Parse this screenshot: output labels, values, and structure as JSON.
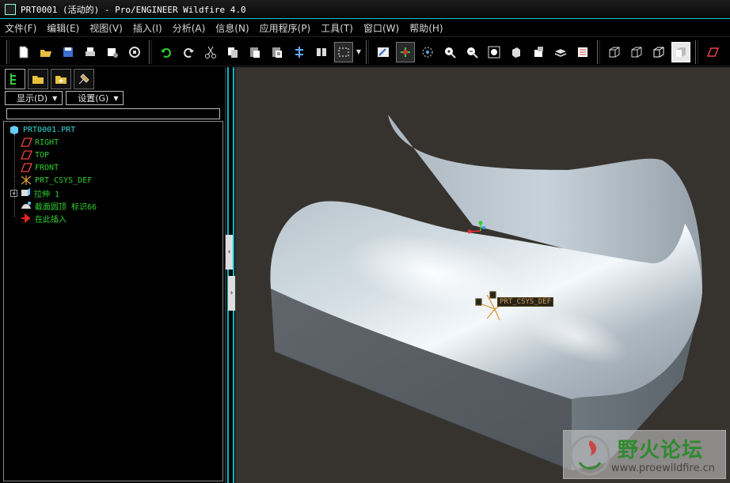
{
  "window": {
    "title": "PRT0001 (活动的) - Pro/ENGINEER Wildfire 4.0"
  },
  "menubar": {
    "items": [
      "文件(F)",
      "编辑(E)",
      "视图(V)",
      "插入(I)",
      "分析(A)",
      "信息(N)",
      "应用程序(P)",
      "工具(T)",
      "窗口(W)",
      "帮助(H)"
    ]
  },
  "toolbar": {
    "icons": [
      "new-file-icon",
      "open-file-icon",
      "save-icon",
      "print-icon",
      "send-email-icon",
      "regen-icon",
      "undo-icon",
      "redo-icon",
      "cut-icon",
      "copy-icon",
      "paste-icon",
      "paste-special-icon",
      "regenerate-icon",
      "find-icon",
      "select-box-icon",
      "repaint-icon",
      "spin-center-icon",
      "orient-icon",
      "zoom-in-icon",
      "zoom-out-icon",
      "refit-icon",
      "reorient-icon",
      "saved-views-icon",
      "layers-icon",
      "view-manager-icon",
      "wireframe-icon",
      "hidden-line-icon",
      "no-hidden-icon",
      "shading-icon",
      "datum-plane-icon"
    ]
  },
  "navigator": {
    "tabs": [
      "model-tree-tab",
      "folder-browser-tab",
      "favorites-tab",
      "connections-tab"
    ],
    "show_label": "显示(D)",
    "settings_label": "设置(G)",
    "tree": [
      {
        "label": "PRT0001.PRT",
        "type": "root"
      },
      {
        "label": "RIGHT",
        "type": "datum-plane"
      },
      {
        "label": "TOP",
        "type": "datum-plane"
      },
      {
        "label": "FRONT",
        "type": "datum-plane"
      },
      {
        "label": "PRT_CSYS_DEF",
        "type": "csys"
      },
      {
        "label": "拉伸 1",
        "type": "extrude"
      },
      {
        "label": "截面圆顶 标识66",
        "type": "section-dome"
      },
      {
        "label": "在此插入",
        "type": "insert-here"
      }
    ]
  },
  "viewport": {
    "csys_label": "PRT_CSYS_DEF",
    "background": "#36332f"
  },
  "watermark": {
    "text": "野火论坛",
    "url": "www.proewildfire.cn"
  },
  "colors": {
    "tree_text": "#2fd02f",
    "root_text": "#33d6d6",
    "accent": "#00b8c8"
  }
}
